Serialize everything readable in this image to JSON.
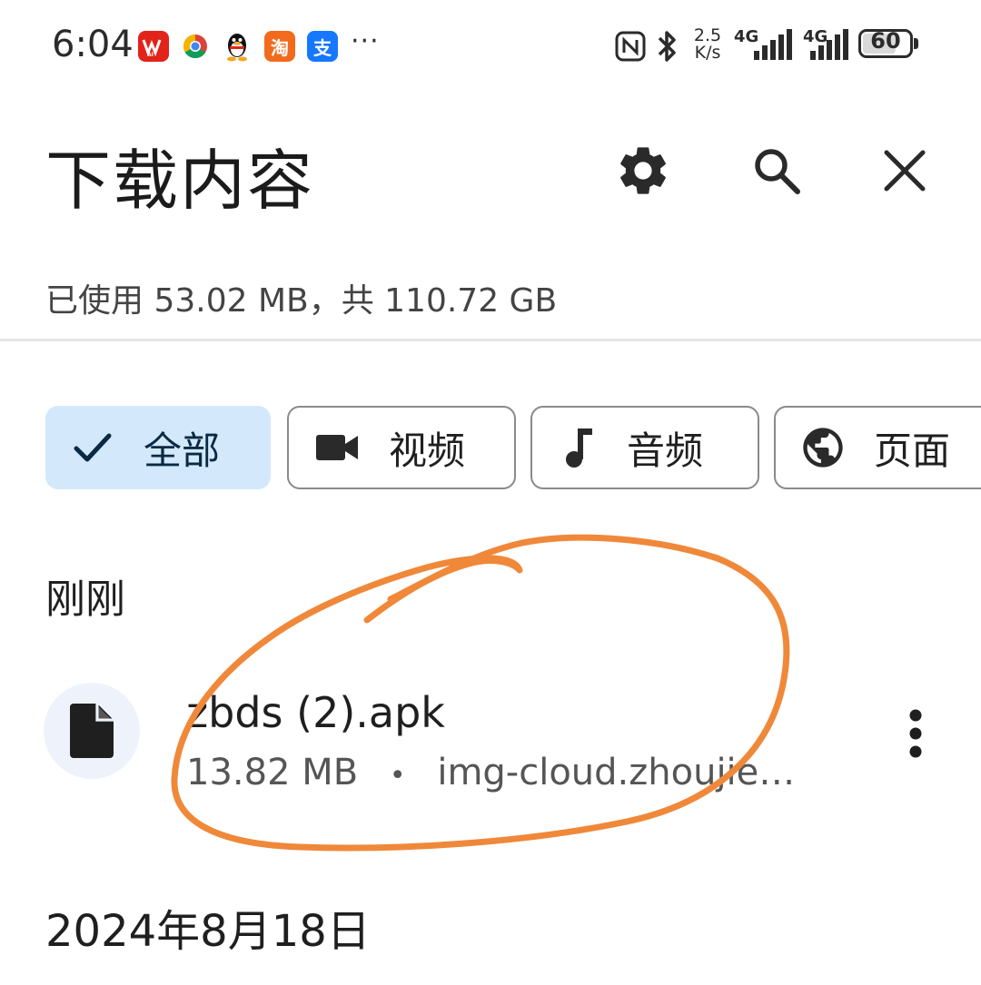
{
  "status_bar": {
    "time": "6:04",
    "app_icons": [
      {
        "icon": "wps-icon",
        "color": "#e2231a"
      },
      {
        "icon": "chrome-icon"
      },
      {
        "icon": "qq-penguin-icon"
      },
      {
        "icon": "taobao-icon",
        "glyph": "淘",
        "color": "#f26b1d"
      },
      {
        "icon": "alipay-icon",
        "glyph": "支",
        "color": "#1677ff"
      }
    ],
    "more": "···",
    "net_speed_value": "2.5",
    "net_speed_unit": "K/s",
    "sim1": "4G",
    "sim2": "4G",
    "battery": "60"
  },
  "header": {
    "title": "下载内容",
    "settings_icon": "gear-icon",
    "search_icon": "search-icon",
    "close_icon": "close-icon"
  },
  "storage": {
    "text": "已使用 53.02 MB，共 110.72 GB"
  },
  "filters": [
    {
      "label": "全部",
      "icon": "check-icon",
      "selected": true
    },
    {
      "label": "视频",
      "icon": "videocam-icon",
      "selected": false
    },
    {
      "label": "音频",
      "icon": "music-note-icon",
      "selected": false
    },
    {
      "label": "页面",
      "icon": "globe-icon",
      "selected": false
    }
  ],
  "sections": [
    {
      "title": "刚刚",
      "items": [
        {
          "name": "zbds (2).apk",
          "size": "13.82 MB",
          "separator": "•",
          "source": "img-cloud.zhoujie…",
          "icon": "file-icon",
          "more_icon": "more-vert-icon"
        }
      ]
    },
    {
      "title": "2024年8月18日"
    }
  ],
  "annotation": {
    "color": "#f0883a"
  }
}
